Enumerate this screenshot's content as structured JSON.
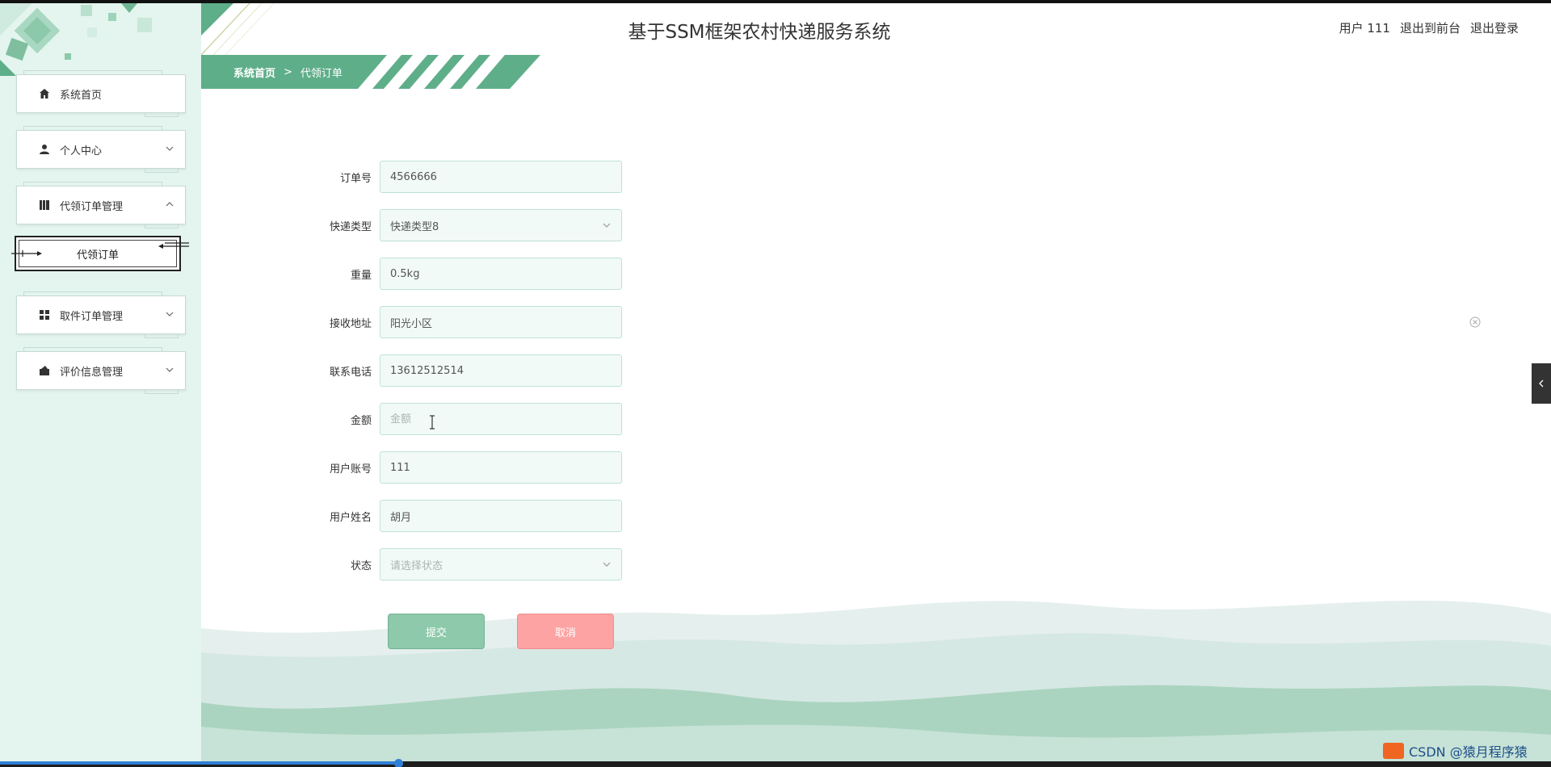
{
  "header": {
    "title": "基于SSM框架农村快递服务系统",
    "user_label": "用户 111",
    "back_to_front": "退出到前台",
    "logout": "退出登录"
  },
  "breadcrumb": {
    "home": "系统首页",
    "separator": ">",
    "current": "代领订单"
  },
  "sidebar": {
    "items": [
      {
        "label": "系统首页",
        "icon": "home-icon"
      },
      {
        "label": "个人中心",
        "icon": "user-icon"
      },
      {
        "label": "代领订单管理",
        "icon": "book-icon"
      },
      {
        "label": "取件订单管理",
        "icon": "grid-icon"
      },
      {
        "label": "评价信息管理",
        "icon": "comment-icon"
      }
    ],
    "submenu": {
      "label": "代领订单"
    }
  },
  "form": {
    "order_no": {
      "label": "订单号",
      "value": "4566666",
      "placeholder": "订单号"
    },
    "express_type": {
      "label": "快递类型",
      "value": "快递类型8"
    },
    "weight": {
      "label": "重量",
      "value": "0.5kg",
      "placeholder": "重量"
    },
    "address": {
      "label": "接收地址",
      "value": "阳光小区",
      "placeholder": "接收地址"
    },
    "phone": {
      "label": "联系电话",
      "value": "13612512514",
      "placeholder": "联系电话"
    },
    "amount": {
      "label": "金额",
      "value": "",
      "placeholder": "金额"
    },
    "account": {
      "label": "用户账号",
      "value": "111",
      "placeholder": "用户账号"
    },
    "name": {
      "label": "用户姓名",
      "value": "胡月",
      "placeholder": "用户姓名"
    },
    "status": {
      "label": "状态",
      "placeholder": "请选择状态"
    }
  },
  "buttons": {
    "submit": "提交",
    "cancel": "取消"
  },
  "watermark": "CSDN @猿月程序猿",
  "colors": {
    "sidebar_bg": "#e3f5ee",
    "accent": "#5fae8a",
    "submit": "#8ec9ab",
    "cancel": "#fda3a3"
  }
}
